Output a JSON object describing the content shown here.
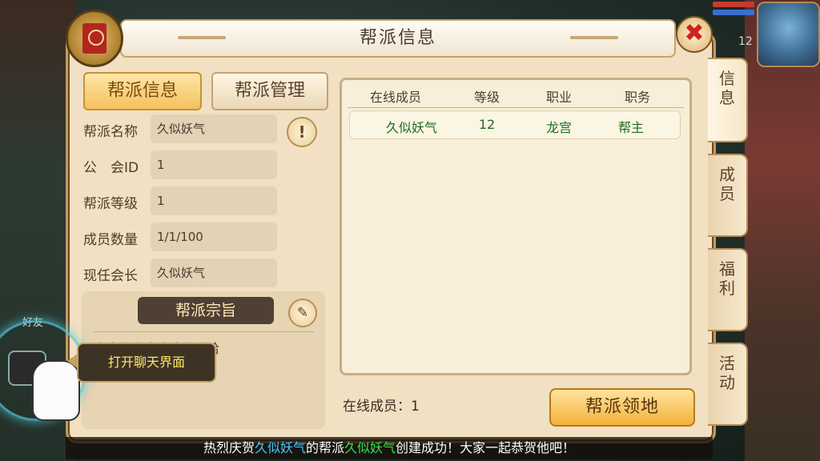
{
  "window": {
    "title": "帮派信息",
    "hud_level": "12"
  },
  "tabs": {
    "info": "帮派信息",
    "manage": "帮派管理"
  },
  "info": {
    "fields": [
      {
        "label": "帮派名称",
        "value": "久似妖气"
      },
      {
        "label": "公　会ID",
        "value": "1"
      },
      {
        "label": "帮派等级",
        "value": "1"
      },
      {
        "label": "成员数量",
        "value": "1/1/100"
      },
      {
        "label": "现任会长",
        "value": "久似妖气"
      }
    ],
    "purpose_title": "帮派宗旨",
    "purpose_text": "哈哈哈哈哈哈哈哈哈哈"
  },
  "members_table": {
    "headers": [
      "在线成员",
      "等级",
      "职业",
      "职务"
    ],
    "rows": [
      {
        "name": "久似妖气",
        "level": "12",
        "class": "龙宫",
        "role": "帮主"
      }
    ]
  },
  "online_count": "在线成员：1",
  "territory_button": "帮派领地",
  "side_tabs": [
    "信息",
    "成员",
    "福利",
    "活动"
  ],
  "tooltip": "打开聊天界面",
  "friend_label": "好友",
  "announcement": {
    "prefix": "热烈庆贺",
    "name1": "久似妖气",
    "mid": "的帮派",
    "name2": "久似妖气",
    "suffix": "创建成功！大家一起恭贺他吧！"
  },
  "icons": {
    "close": "close-icon",
    "alert": "exclamation-icon",
    "edit": "pencil-icon",
    "emblem": "guild-flag-icon",
    "chat": "chat-icon",
    "hand": "pointing-hand-icon"
  },
  "colors": {
    "accent": "#f3b13b",
    "member_text": "#1f6b1f",
    "close": "#d0231b",
    "highlight_blue": "#49c8ff",
    "highlight_green": "#35e04b"
  }
}
